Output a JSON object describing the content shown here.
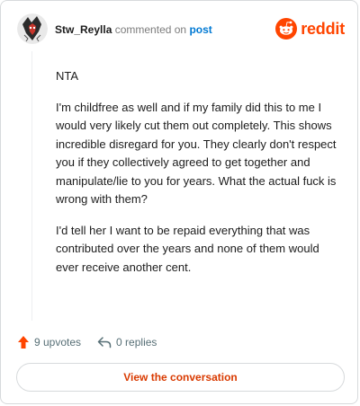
{
  "header": {
    "username": "Stw_Reylla",
    "action_text": "commented on",
    "post_link": "post",
    "logo_text": "reddit"
  },
  "comment": {
    "paragraphs": [
      "NTA",
      "I'm childfree as well and if my family did this to me I would very likely cut them out completely. This shows incredible disregard for you. They clearly don't respect you if they collectively agreed to get together and manipulate/lie to you for years. What the actual fuck is wrong with them?",
      "I'd tell her I want to be repaid everything that was contributed over the years and none of them would ever receive another cent."
    ]
  },
  "actions": {
    "upvotes": "9 upvotes",
    "replies": "0 replies"
  },
  "cta": {
    "label": "View the conversation"
  },
  "icons": {
    "avatar": "user-avatar",
    "logo": "reddit-logo-icon",
    "upvote": "upvote-arrow-icon",
    "reply": "reply-arrow-icon"
  },
  "colors": {
    "brand": "#ff4500",
    "link": "#0079d3",
    "cta_text": "#d93a00",
    "muted": "#576f76"
  }
}
